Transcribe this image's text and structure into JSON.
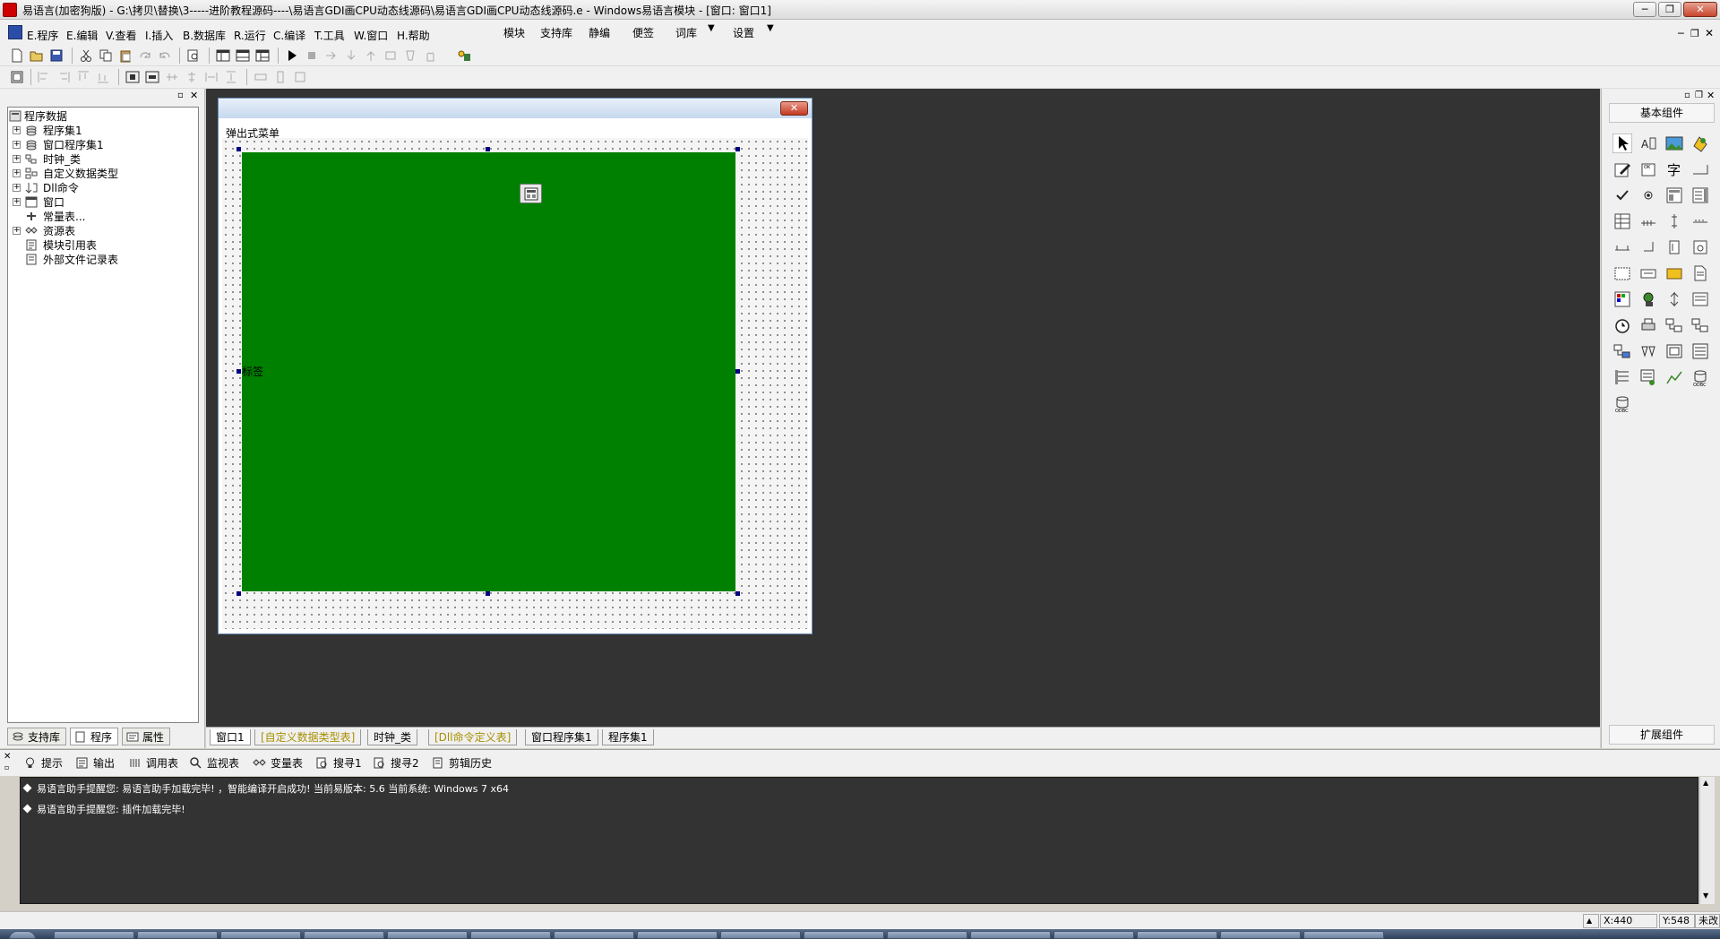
{
  "titlebar": {
    "title": "易语言(加密狗版) - G:\\拷贝\\替换\\3-----进阶教程源码----\\易语言GDI画CPU动态线源码\\易语言GDI画CPU动态线源码.e - Windows易语言模块 - [窗口: 窗口1]",
    "minimize": "─",
    "restore": "❐",
    "close": "✕"
  },
  "menu": {
    "items": [
      "E.程序",
      "E.编辑",
      "V.查看",
      "I.插入",
      "B.数据库",
      "R.运行",
      "C.编译",
      "T.工具",
      "W.窗口",
      "H.帮助"
    ],
    "extra": [
      "模块",
      "支持库",
      "静编",
      "便签",
      "词库",
      "设置"
    ]
  },
  "left_panel": {
    "tree": [
      {
        "label": "程序数据",
        "icon": "program-data-icon"
      },
      {
        "label": "程序集1",
        "icon": "assembly-icon"
      },
      {
        "label": "窗口程序集1",
        "icon": "assembly-icon"
      },
      {
        "label": "时钟_类",
        "icon": "class-icon"
      },
      {
        "label": "自定义数据类型",
        "icon": "datatype-icon"
      },
      {
        "label": "Dll命令",
        "icon": "dll-icon"
      },
      {
        "label": "窗口",
        "icon": "window-icon"
      },
      {
        "label": "常量表...",
        "icon": "constant-icon"
      },
      {
        "label": "资源表",
        "icon": "resource-icon"
      },
      {
        "label": "模块引用表",
        "icon": "module-ref-icon"
      },
      {
        "label": "外部文件记录表",
        "icon": "external-file-icon"
      }
    ],
    "tabs": [
      "支持库",
      "程序",
      "属性"
    ]
  },
  "form": {
    "popup_menu_label": "弹出式菜单",
    "label_text": "标签",
    "close": "✕"
  },
  "doc_tabs": [
    "窗口1",
    "[自定义数据类型表]",
    "时钟_类",
    "[Dll命令定义表]",
    "窗口程序集1",
    "程序集1"
  ],
  "right_panel": {
    "header": "基本组件",
    "footer": "扩展组件"
  },
  "output": {
    "tabs": [
      "提示",
      "输出",
      "调用表",
      "监视表",
      "变量表",
      "搜寻1",
      "搜寻2",
      "剪辑历史"
    ],
    "lines": [
      "易语言助手提醒您: 易语言助手加载完毕! ，智能编译开启成功! 当前易版本: 5.6  当前系统: Windows 7 x64",
      "易语言助手提醒您: 插件加载完毕!"
    ]
  },
  "status": {
    "x": "X:440",
    "y": "Y:548",
    "state": "未改"
  },
  "colors": {
    "workspace": "#333333",
    "label_bg": "#008000",
    "selection_handle": "#000080"
  }
}
